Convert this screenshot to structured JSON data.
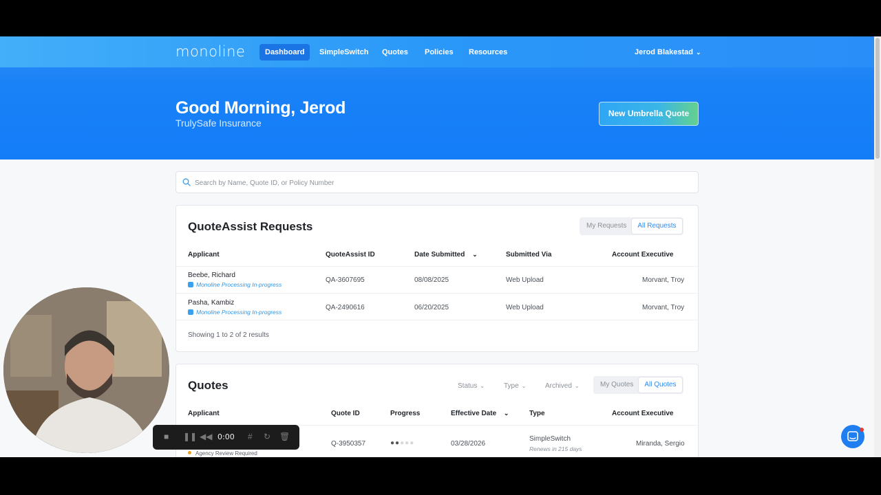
{
  "nav": {
    "logo": "monoline",
    "items": [
      {
        "label": "Dashboard",
        "active": true
      },
      {
        "label": "SimpleSwitch",
        "active": false
      },
      {
        "label": "Quotes",
        "active": false
      },
      {
        "label": "Policies",
        "active": false
      },
      {
        "label": "Resources",
        "active": false
      }
    ],
    "user": "Jerod Blakestad"
  },
  "hero": {
    "greeting": "Good Morning, Jerod",
    "agency": "TrulySafe Insurance",
    "cta_label": "New Umbrella Quote"
  },
  "search": {
    "placeholder": "Search by Name, Quote ID, or Policy Number",
    "value": ""
  },
  "quoteassist": {
    "title": "QuoteAssist Requests",
    "toggle": [
      "My Requests",
      "All Requests"
    ],
    "toggle_selected": "All Requests",
    "columns": [
      "Applicant",
      "QuoteAssist ID",
      "Date Submitted",
      "Submitted Via",
      "Account Executive"
    ],
    "rows": [
      {
        "applicant": "Beebe, Richard",
        "status": "Monoline Processing In-progress",
        "id": "QA-3607695",
        "date": "08/08/2025",
        "via": "Web Upload",
        "exec": "Morvant, Troy"
      },
      {
        "applicant": "Pasha, Kambiz",
        "status": "Monoline Processing In-progress",
        "id": "QA-2490616",
        "date": "06/20/2025",
        "via": "Web Upload",
        "exec": "Morvant, Troy"
      }
    ],
    "footer": "Showing 1 to 2 of 2 results"
  },
  "quotes": {
    "title": "Quotes",
    "filters": [
      "Status",
      "Type",
      "Archived"
    ],
    "toggle": [
      "My Quotes",
      "All Quotes"
    ],
    "toggle_selected": "All Quotes",
    "columns": [
      "Applicant",
      "Quote ID",
      "Progress",
      "Effective Date",
      "Type",
      "Account Executive"
    ],
    "rows": [
      {
        "status": "Agency Review Required",
        "id": "Q-3950357",
        "progress_steps_done": 2,
        "progress_steps_total": 5,
        "date": "03/28/2026",
        "type": "SimpleSwitch",
        "renews": "Renews in 215 days",
        "exec": "Miranda, Sergio"
      }
    ]
  },
  "recorder": {
    "time": "0:00"
  },
  "colors": {
    "brand_blue": "#1a82f7",
    "accent_link": "#2b8af3",
    "status_text": "#2f96e6",
    "warning_dot": "#f0a020"
  }
}
